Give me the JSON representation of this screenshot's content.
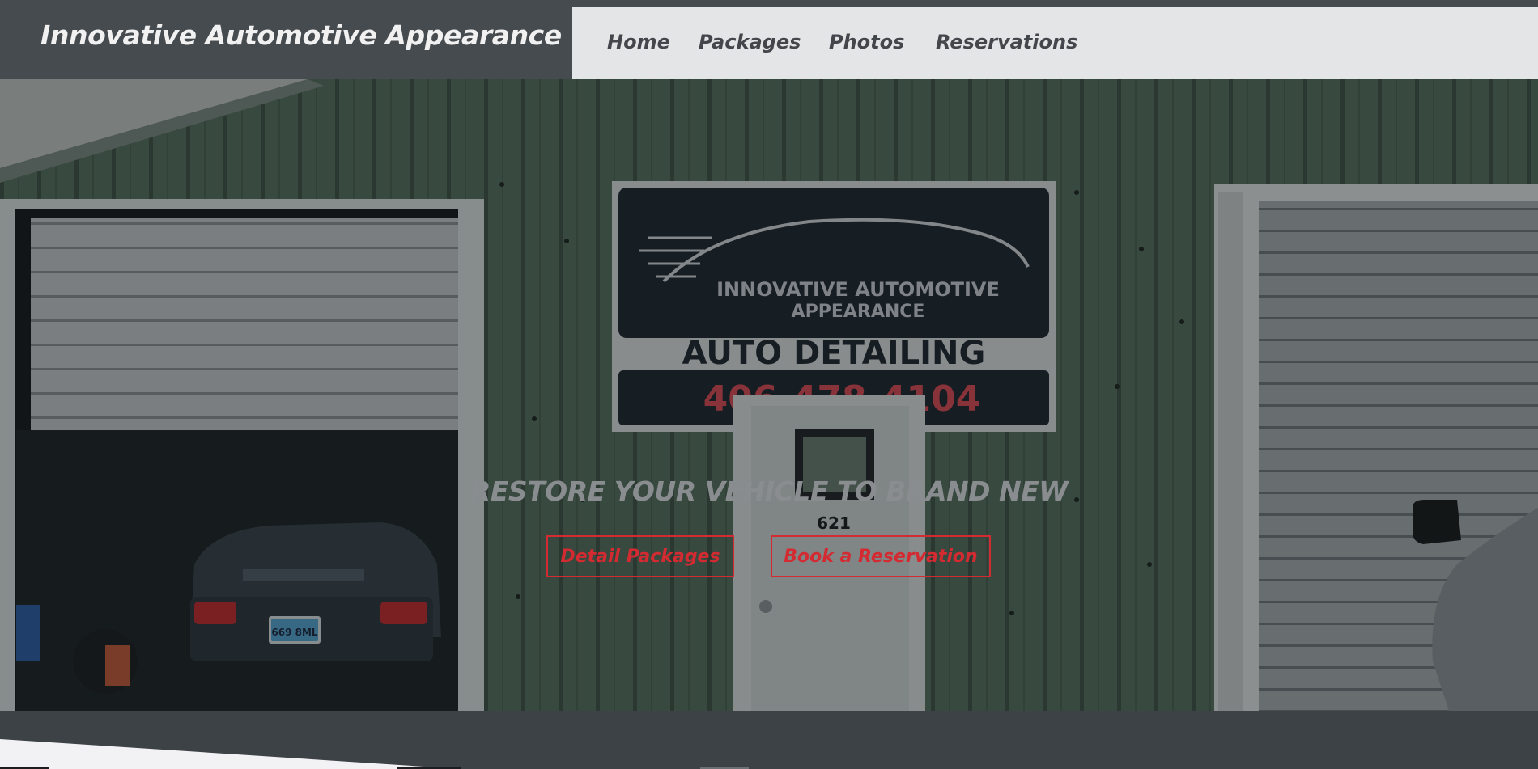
{
  "header": {
    "brand": "Innovative Automotive Appearance",
    "nav": [
      {
        "label": "Home"
      },
      {
        "label": "Packages"
      },
      {
        "label": "Photos"
      },
      {
        "label": "Reservations"
      }
    ]
  },
  "hero": {
    "headline": "RESTORE YOUR VEHICLE TO BRAND NEW",
    "buttons": {
      "packages": "Detail Packages",
      "reservation": "Book a Reservation"
    },
    "photo": {
      "sign_line1": "INNOVATIVE AUTOMOTIVE",
      "sign_line2": "APPEARANCE",
      "sign_line3": "AUTO DETAILING",
      "sign_phone": "406-478-4104",
      "door_number": "621",
      "plate": "669 8ML"
    }
  },
  "colors": {
    "brand_bar": "#464b50",
    "nav_bg": "#e4e5e6",
    "accent_red": "#d42a31",
    "page_bg": "#3d4247"
  }
}
